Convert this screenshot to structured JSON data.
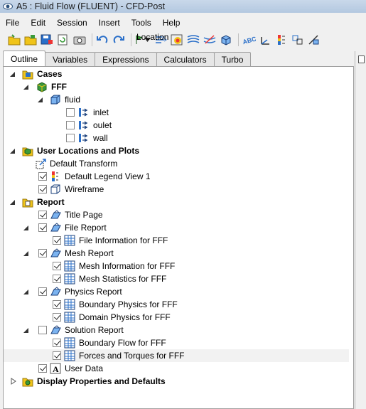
{
  "window": {
    "title": "A5 : Fluid Flow (FLUENT) - CFD-Post"
  },
  "menu": [
    "File",
    "Edit",
    "Session",
    "Insert",
    "Tools",
    "Help"
  ],
  "toolbar": {
    "location_label": "Location"
  },
  "tabs": [
    "Outline",
    "Variables",
    "Expressions",
    "Calculators",
    "Turbo"
  ],
  "active_tab": "Outline",
  "tree": {
    "cases": {
      "label": "Cases",
      "fff": "FFF",
      "fluid": "fluid",
      "inlet": "inlet",
      "oulet": "oulet",
      "wall": "wall"
    },
    "user_locations": {
      "label": "User Locations and Plots",
      "default_transform": "Default Transform",
      "legend": "Default Legend View 1",
      "wireframe": "Wireframe"
    },
    "report": {
      "label": "Report",
      "title_page": "Title Page",
      "file_report": "File Report",
      "file_info": "File Information for FFF",
      "mesh_report": "Mesh Report",
      "mesh_info": "Mesh Information for FFF",
      "mesh_stats": "Mesh Statistics for FFF",
      "physics_report": "Physics Report",
      "boundary_physics": "Boundary Physics for FFF",
      "domain_physics": "Domain Physics for FFF",
      "solution_report": "Solution Report",
      "boundary_flow": "Boundary Flow for FFF",
      "forces_torques": "Forces and Torques for FFF",
      "user_data": "User Data"
    },
    "display": {
      "label": "Display Properties and Defaults"
    }
  },
  "colors": {
    "titlebar": "#b3c8e0",
    "panel_bg": "#ffffff",
    "icon_blue": "#2a6fc9",
    "icon_yellow": "#f0c419",
    "icon_green": "#3a9a3a"
  }
}
